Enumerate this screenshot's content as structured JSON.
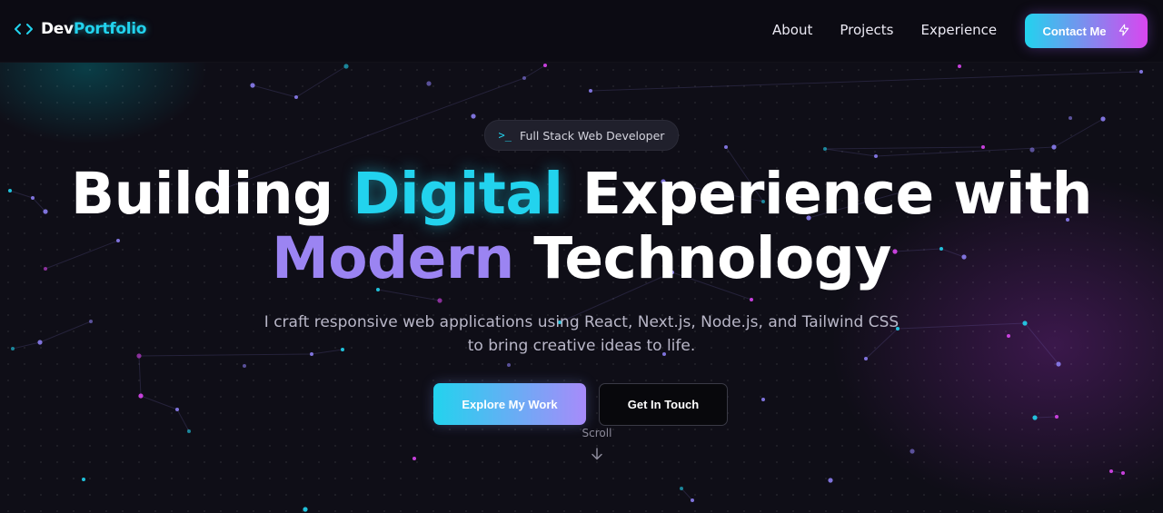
{
  "brand": {
    "name_part1": "Dev",
    "name_part2": "Portfolio",
    "icon": "code-brackets-icon",
    "accent": "#22d3ee"
  },
  "nav": {
    "items": [
      "About",
      "Projects",
      "Experience"
    ],
    "cta_label": "Contact Me",
    "cta_icon": "lightning-icon"
  },
  "hero": {
    "badge_icon": "terminal-icon",
    "badge": "Full Stack Web Developer",
    "title": {
      "part1": "Building ",
      "highlight1": "Digital",
      "part2": " Experience with",
      "highlight2": "Modern",
      "part3": " Technology"
    },
    "subtitle": "I craft responsive web applications using React, Next.js, Node.js, and Tailwind CSS to bring creative ideas to life.",
    "primary_button": "Explore My Work",
    "secondary_button": "Get In Touch",
    "scroll_label": "Scroll",
    "scroll_icon": "arrow-down-icon"
  },
  "colors": {
    "cyan": "#22d3ee",
    "violet": "#9b84f2",
    "magenta": "#d946ef",
    "background": "#0f0e17"
  }
}
